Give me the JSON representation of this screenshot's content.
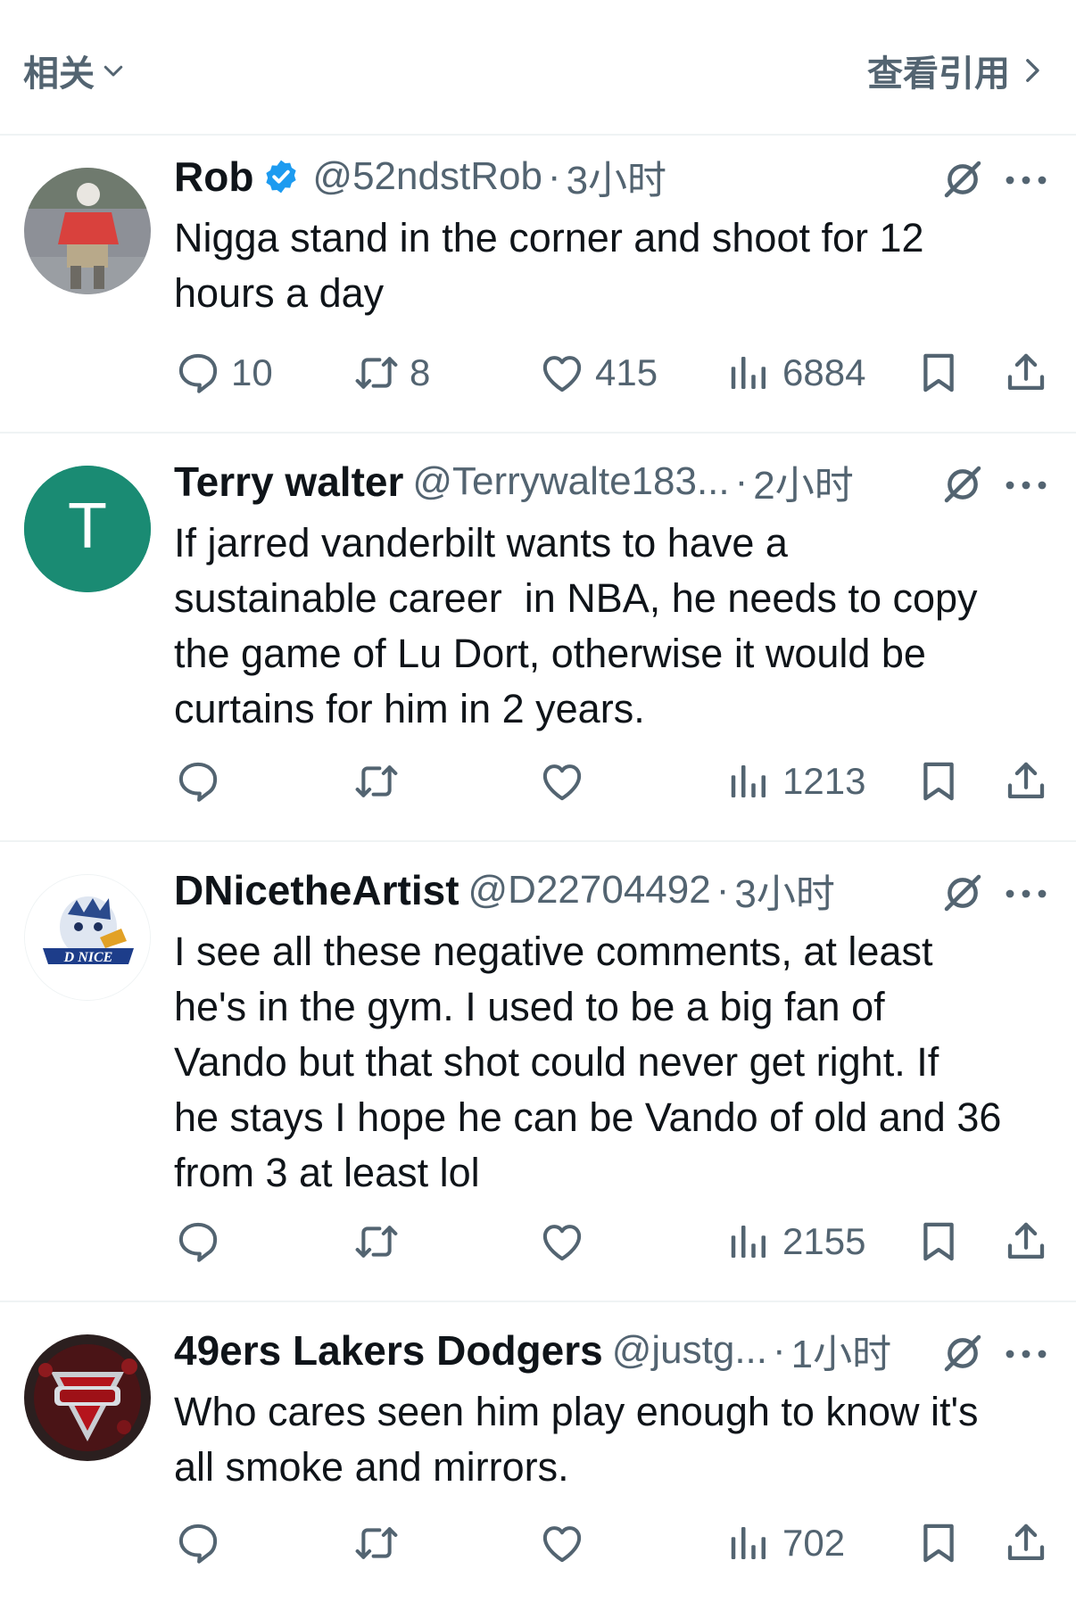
{
  "header": {
    "sort_label": "相关",
    "quotes_label": "查看引用"
  },
  "posts": [
    {
      "display_name": "Rob",
      "verified": true,
      "handle": "@52ndstRob",
      "separator": "·",
      "time": "3小时",
      "text": "Nigga stand in the corner and shoot for 12\nhours a day",
      "replies": "10",
      "reposts": "8",
      "likes": "415",
      "views": "6884"
    },
    {
      "display_name": "Terry walter",
      "verified": false,
      "handle": "@Terrywalte183...",
      "separator": "·",
      "time": "2小时",
      "avatar_letter": "T",
      "text": "If jarred vanderbilt wants to have a\nsustainable career  in NBA, he needs to copy\nthe game of Lu Dort, otherwise it would be\ncurtains for him in 2 years.",
      "replies": "",
      "reposts": "",
      "likes": "",
      "views": "1213"
    },
    {
      "display_name": "DNicetheArtist",
      "verified": false,
      "handle": "@D22704492",
      "separator": "·",
      "time": "3小时",
      "avatar_logo_text": "D NICE",
      "text": "I see all these negative comments, at least\nhe's in the gym. I used to be a big fan of\nVando but that shot could never get right. If\nhe stays I hope he can be Vando of old and 36\nfrom 3 at least lol",
      "replies": "",
      "reposts": "",
      "likes": "",
      "views": "2155"
    },
    {
      "display_name": "49ers Lakers Dodgers",
      "verified": false,
      "handle": "@justg...",
      "separator": "·",
      "time": "1小时",
      "text": "Who cares seen him play enough to know it's\nall smoke and mirrors.",
      "replies": "",
      "reposts": "",
      "likes": "",
      "views": "702"
    }
  ],
  "colors": {
    "text_primary": "#0f1419",
    "text_secondary": "#536471",
    "verified_blue": "#1d9bf0",
    "divider": "#eff3f4",
    "avatar_teal": "#1a8b73"
  },
  "icons": [
    "chevron-down-icon",
    "chevron-right-icon",
    "verified-badge-icon",
    "grok-icon",
    "more-icon",
    "reply-icon",
    "repost-icon",
    "like-icon",
    "views-icon",
    "bookmark-icon",
    "share-icon"
  ]
}
